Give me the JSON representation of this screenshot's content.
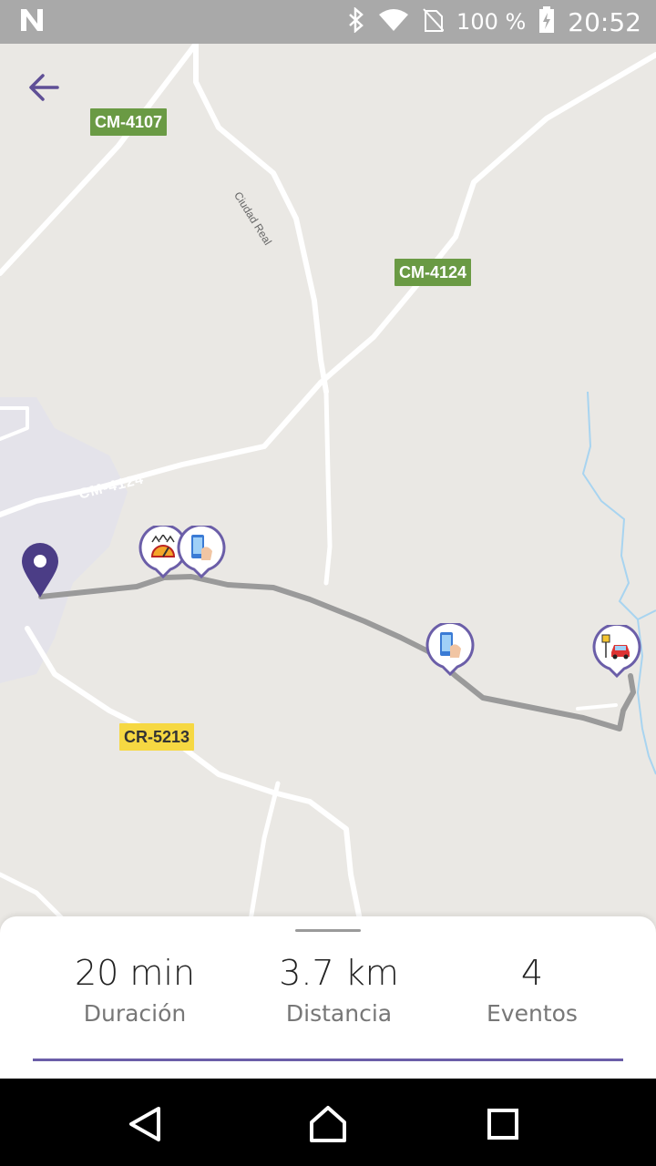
{
  "status_bar": {
    "battery_text": "100 %",
    "time": "20:52",
    "icons": [
      "notification-n-icon",
      "bluetooth-icon",
      "wifi-icon",
      "no-sim-icon",
      "battery-charging-icon"
    ]
  },
  "map": {
    "road_shields": {
      "cm4107": "CM-4107",
      "cm4124": "CM-4124",
      "cm4124_road": "CM-4124",
      "cr5213": "CR-5213"
    },
    "road_label_ciudad_real": "Ciudad Real",
    "route_color": "#9a9a9a",
    "accent_color": "#5f4f96",
    "events": [
      {
        "name": "speeding-event",
        "icon": "speedometer-icon"
      },
      {
        "name": "phone-use-event",
        "icon": "phone-hand-icon"
      },
      {
        "name": "phone-use-event-2",
        "icon": "phone-hand-icon"
      },
      {
        "name": "parking-event",
        "icon": "parked-car-icon"
      }
    ]
  },
  "summary": {
    "duration_value": "20 min",
    "duration_label": "Duración",
    "distance_value": "3.7 km",
    "distance_label": "Distancia",
    "events_value": "4",
    "events_label": "Eventos"
  },
  "nav": {
    "icons": [
      "back-triangle-icon",
      "home-icon",
      "recents-square-icon"
    ]
  }
}
